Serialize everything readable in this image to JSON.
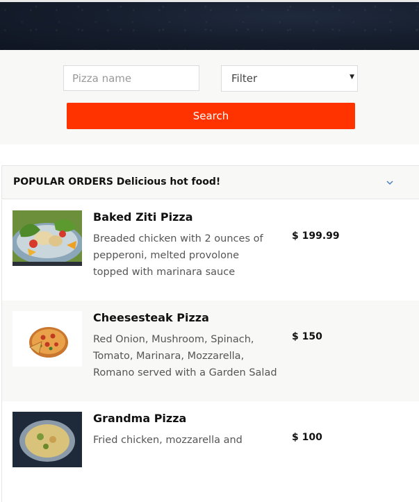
{
  "search": {
    "name_placeholder": "Pizza name",
    "filter_value": "Filter",
    "search_label": "Search"
  },
  "popular": {
    "title": "POPULAR ORDERS Delicious hot food!"
  },
  "items": [
    {
      "name": "Baked Ziti Pizza",
      "description": "Breaded chicken with 2 ounces of pepperoni, melted provolone topped with marinara sauce",
      "price": "$ 199.99"
    },
    {
      "name": "Cheesesteak Pizza",
      "description": "Red Onion, Mushroom, Spinach, Tomato, Marinara, Mozzarella, Romano served with a Garden Salad",
      "price": "$ 150"
    },
    {
      "name": "Grandma Pizza",
      "description": "Fried chicken, mozzarella and",
      "price": "$ 100"
    }
  ],
  "colors": {
    "accent": "#ff3300",
    "hero": "#151d2c",
    "chevron": "#4a7fc1"
  }
}
